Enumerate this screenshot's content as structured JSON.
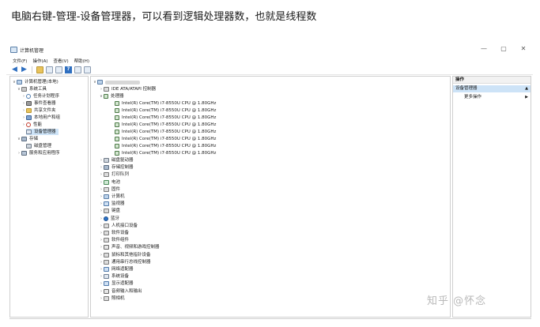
{
  "caption": "电脑右键-管理-设备管理器，可以看到逻辑处理器数，也就是线程数",
  "window": {
    "title": "计算机管理",
    "controls": {
      "minimize": "—",
      "maximize": "▢",
      "close": "✕"
    }
  },
  "menu": [
    "文件(F)",
    "操作(A)",
    "查看(V)",
    "帮助(H)"
  ],
  "left_tree": {
    "root": "计算机管理(本地)",
    "system_tools": "系统工具",
    "items": [
      "任务计划程序",
      "事件查看器",
      "共享文件夹",
      "本地用户和组",
      "性能",
      "设备管理器"
    ],
    "storage": "存储",
    "disk_mgmt": "磁盘管理",
    "services": "服务和应用程序"
  },
  "device_tree": {
    "ide": "IDE ATA/ATAPI 控制器",
    "processors": "处理器",
    "cpu_name": "Intel(R) Core(TM) i7-8550U CPU @ 1.80GHz",
    "cpu_count": 8,
    "categories": [
      "磁盘驱动器",
      "存储控制器",
      "打印队列",
      "电池",
      "固件",
      "计算机",
      "监视器",
      "键盘",
      "蓝牙",
      "人机接口设备",
      "软件设备",
      "软件组件",
      "声音、视频和游戏控制器",
      "鼠标和其他指针设备",
      "通用串行总线控制器",
      "网络适配器",
      "系统设备",
      "显示适配器",
      "音频输入和输出",
      "照相机"
    ]
  },
  "actions_pane": {
    "header": "操作",
    "section": "设备管理器",
    "more": "更多操作",
    "caret_up": "▲",
    "caret_right": "▶"
  },
  "watermark": "知乎 @怀念"
}
